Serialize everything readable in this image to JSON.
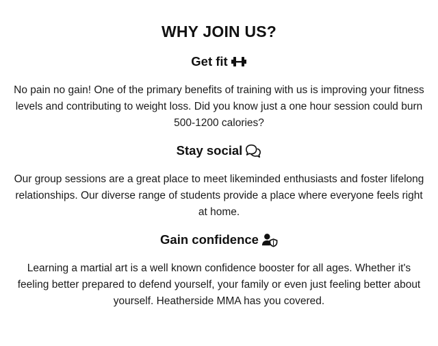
{
  "section": {
    "title": "WHY JOIN US?"
  },
  "benefits": [
    {
      "heading": "Get fit",
      "icon": "dumbbell-icon",
      "text": "No pain no gain! One of the primary benefits of training with us is improving your fitness levels and contributing to weight loss. Did you know just a one hour session could burn 500-1200 calories?"
    },
    {
      "heading": "Stay social",
      "icon": "chat-bubbles-icon",
      "text": "Our group sessions are a great place to meet likeminded enthusiasts and foster lifelong relationships. Our diverse range of students provide a place where everyone feels right at home."
    },
    {
      "heading": "Gain confidence",
      "icon": "user-shield-icon",
      "text": "Learning a martial art is a well known confidence booster for all ages. Whether it's feeling better prepared to defend yourself, your family or even just feeling better about yourself. Heatherside MMA has you covered."
    }
  ],
  "colors": {
    "background": "#ffffff",
    "text": "#111111"
  }
}
